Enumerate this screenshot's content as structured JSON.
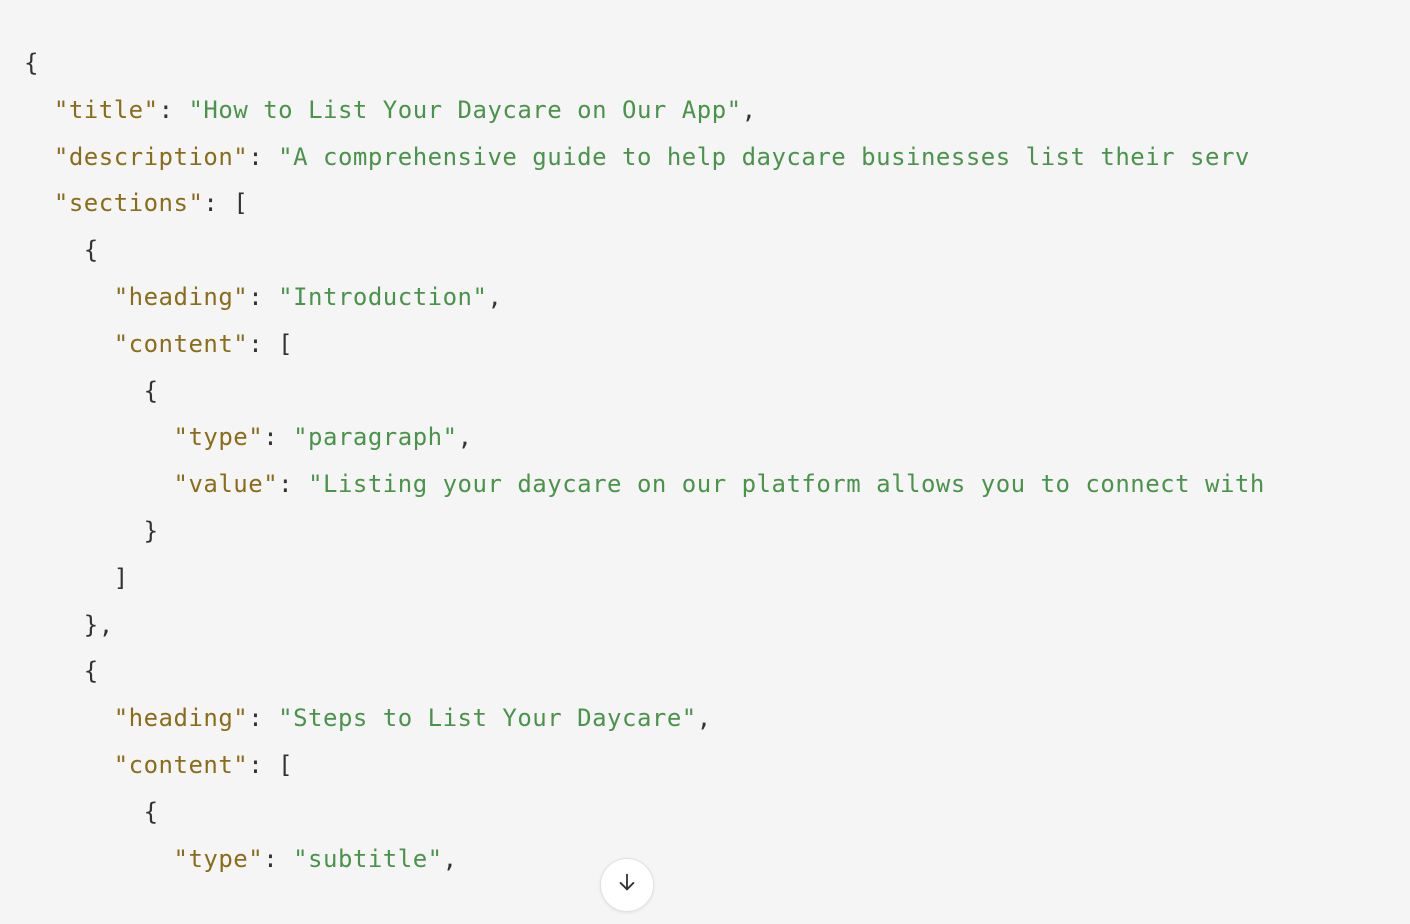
{
  "code": {
    "line01": "{",
    "line02_indent": "  ",
    "line02_key": "\"title\"",
    "line02_colon": ": ",
    "line02_val": "\"How to List Your Daycare on Our App\"",
    "line02_end": ",",
    "line03_indent": "  ",
    "line03_key": "\"description\"",
    "line03_colon": ": ",
    "line03_val": "\"A comprehensive guide to help daycare businesses list their serv",
    "line04_indent": "  ",
    "line04_key": "\"sections\"",
    "line04_colon": ": ",
    "line04_val": "[",
    "line05": "    {",
    "line06_indent": "      ",
    "line06_key": "\"heading\"",
    "line06_colon": ": ",
    "line06_val": "\"Introduction\"",
    "line06_end": ",",
    "line07_indent": "      ",
    "line07_key": "\"content\"",
    "line07_colon": ": ",
    "line07_val": "[",
    "line08": "        {",
    "line09_indent": "          ",
    "line09_key": "\"type\"",
    "line09_colon": ": ",
    "line09_val": "\"paragraph\"",
    "line09_end": ",",
    "line10_indent": "          ",
    "line10_key": "\"value\"",
    "line10_colon": ": ",
    "line10_val": "\"Listing your daycare on our platform allows you to connect with",
    "line11": "        }",
    "line12": "      ]",
    "line13": "    },",
    "line14": "    {",
    "line15_indent": "      ",
    "line15_key": "\"heading\"",
    "line15_colon": ": ",
    "line15_val": "\"Steps to List Your Daycare\"",
    "line15_end": ",",
    "line16_indent": "      ",
    "line16_key": "\"content\"",
    "line16_colon": ": ",
    "line16_val": "[",
    "line17": "        {",
    "line18_indent": "          ",
    "line18_key": "\"type\"",
    "line18_colon": ": ",
    "line18_val": "\"subtitle\"",
    "line18_end": ","
  }
}
